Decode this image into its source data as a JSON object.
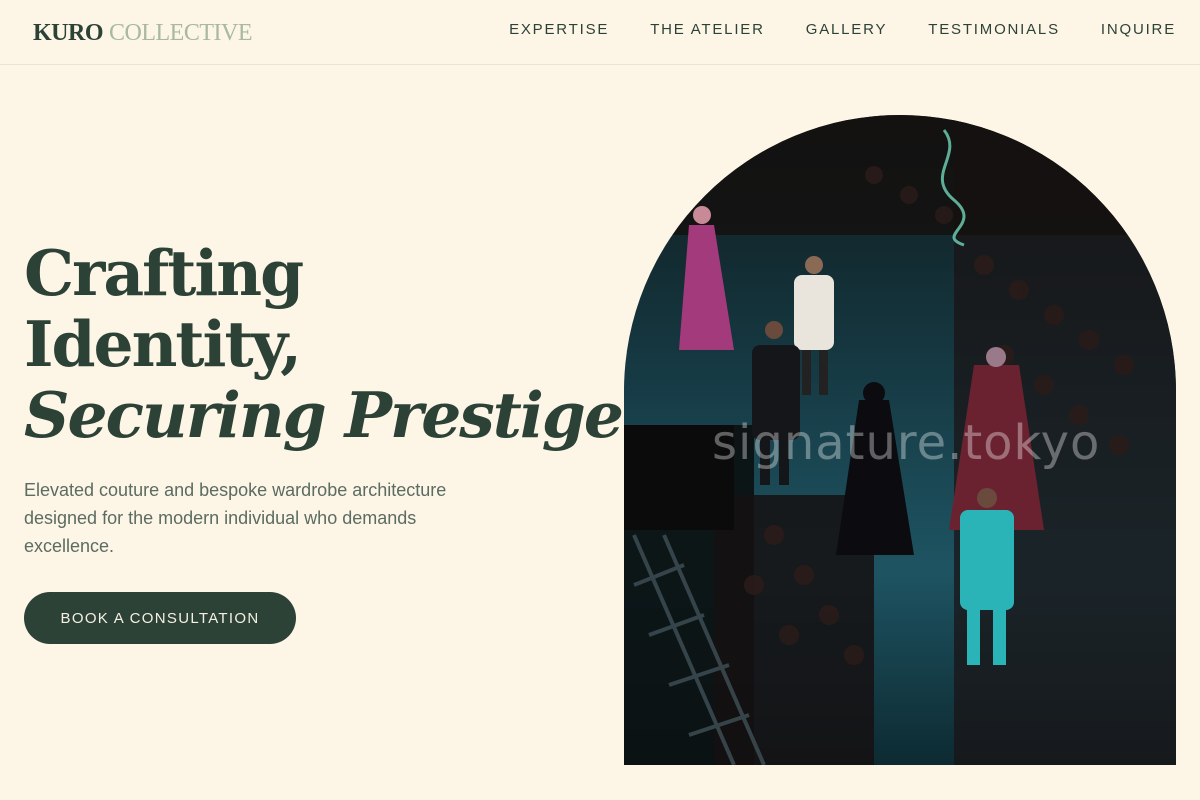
{
  "brand": {
    "name_primary": "KURO",
    "name_secondary": "COLLECTIVE"
  },
  "nav": {
    "items": [
      {
        "label": "EXPERTISE"
      },
      {
        "label": "THE ATELIER"
      },
      {
        "label": "GALLERY"
      },
      {
        "label": "TESTIMONIALS"
      },
      {
        "label": "INQUIRE"
      }
    ]
  },
  "hero": {
    "title_line1": "Crafting",
    "title_line2": "Identity,",
    "title_line3": "Securing Prestige.",
    "subtitle": "Elevated couture and bespoke wardrobe architecture designed for the modern individual who demands excellence.",
    "cta_label": "BOOK A CONSULTATION"
  },
  "image": {
    "alt": "Fashion runway show with models walking past a seated audience",
    "watermark": "signature.tokyo"
  },
  "colors": {
    "background": "#fdf5e6",
    "primary": "#2d4237",
    "accent": "#a8b99f"
  }
}
